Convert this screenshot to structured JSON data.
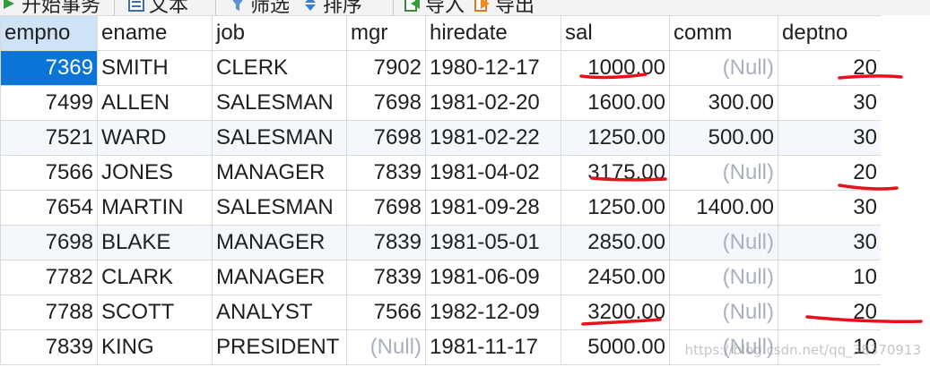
{
  "toolbar": {
    "begin_transaction": "开始事务",
    "text": "文本",
    "filter": "筛选",
    "sort": "排序",
    "import": "导入",
    "export": "导出"
  },
  "columns": [
    "empno",
    "ename",
    "job",
    "mgr",
    "hiredate",
    "sal",
    "comm",
    "deptno"
  ],
  "rows": [
    {
      "empno": "7369",
      "ename": "SMITH",
      "job": "CLERK",
      "mgr": "7902",
      "hiredate": "1980-12-17",
      "sal": "1000.00",
      "comm": "(Null)",
      "deptno": "20"
    },
    {
      "empno": "7499",
      "ename": "ALLEN",
      "job": "SALESMAN",
      "mgr": "7698",
      "hiredate": "1981-02-20",
      "sal": "1600.00",
      "comm": "300.00",
      "deptno": "30"
    },
    {
      "empno": "7521",
      "ename": "WARD",
      "job": "SALESMAN",
      "mgr": "7698",
      "hiredate": "1981-02-22",
      "sal": "1250.00",
      "comm": "500.00",
      "deptno": "30"
    },
    {
      "empno": "7566",
      "ename": "JONES",
      "job": "MANAGER",
      "mgr": "7839",
      "hiredate": "1981-04-02",
      "sal": "3175.00",
      "comm": "(Null)",
      "deptno": "20"
    },
    {
      "empno": "7654",
      "ename": "MARTIN",
      "job": "SALESMAN",
      "mgr": "7698",
      "hiredate": "1981-09-28",
      "sal": "1250.00",
      "comm": "1400.00",
      "deptno": "30"
    },
    {
      "empno": "7698",
      "ename": "BLAKE",
      "job": "MANAGER",
      "mgr": "7839",
      "hiredate": "1981-05-01",
      "sal": "2850.00",
      "comm": "(Null)",
      "deptno": "30"
    },
    {
      "empno": "7782",
      "ename": "CLARK",
      "job": "MANAGER",
      "mgr": "7839",
      "hiredate": "1981-06-09",
      "sal": "2450.00",
      "comm": "(Null)",
      "deptno": "10"
    },
    {
      "empno": "7788",
      "ename": "SCOTT",
      "job": "ANALYST",
      "mgr": "7566",
      "hiredate": "1982-12-09",
      "sal": "3200.00",
      "comm": "(Null)",
      "deptno": "20"
    },
    {
      "empno": "7839",
      "ename": "KING",
      "job": "PRESIDENT",
      "mgr": "(Null)",
      "hiredate": "1981-11-17",
      "sal": "5000.00",
      "comm": "(Null)",
      "deptno": "10"
    }
  ],
  "watermark": "https://blog.csdn.net/qq_38370913",
  "colors": {
    "selected_cell": "#0b74d7",
    "selected_header": "#cfe3f7",
    "null_text": "#a9b0bf",
    "annotation_red": "#e8101a"
  }
}
